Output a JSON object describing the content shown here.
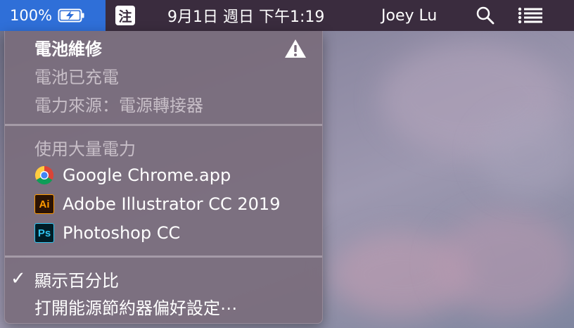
{
  "menubar": {
    "battery_percent": "100%",
    "ime_label": "注",
    "datetime": "9月1日 週日 下午1:19",
    "user_name": "Joey Lu"
  },
  "battery_menu": {
    "condition": "電池維修",
    "status": "電池已充電",
    "power_source": "電力來源：電源轉接器",
    "apps_header": "使用大量電力",
    "apps": [
      {
        "label": "Google Chrome.app",
        "icon": "chrome-icon"
      },
      {
        "label": "Adobe Illustrator CC 2019",
        "icon": "illustrator-icon",
        "icon_text": "Ai"
      },
      {
        "label": "Photoshop CC",
        "icon": "photoshop-icon",
        "icon_text": "Ps"
      }
    ],
    "show_percentage": "顯示百分比",
    "show_percentage_checked": true,
    "open_energy_saver": "打開能源節約器偏好設定⋯"
  },
  "colors": {
    "menubar": "#3a2c3e",
    "battery_highlight": "#2f6fd8",
    "menu_bg": "#7a6c7c"
  }
}
